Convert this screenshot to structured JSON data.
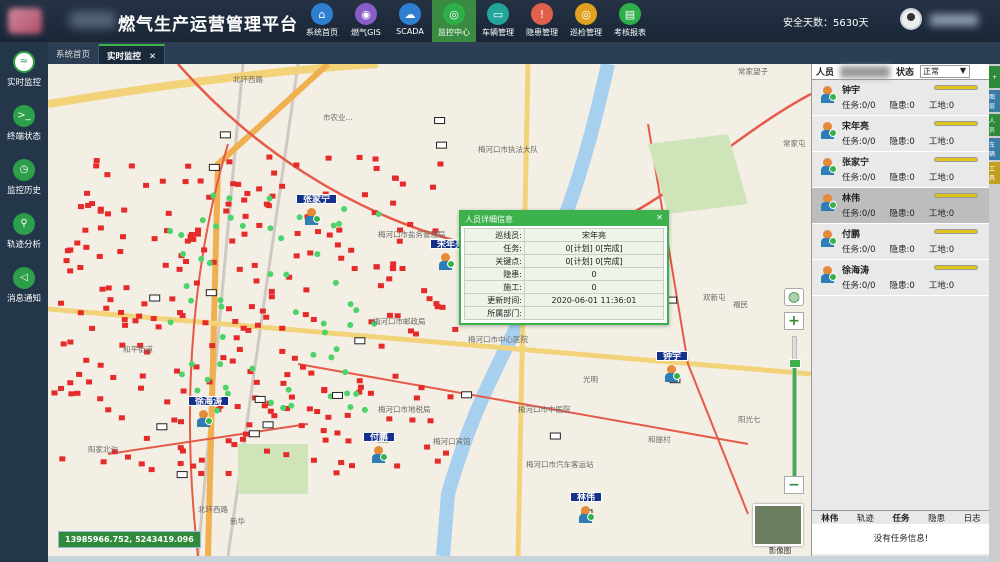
{
  "app": {
    "title": "燃气生产运营管理平台",
    "safety_days": "安全天数：5630天"
  },
  "nav": [
    {
      "label": "系统首页",
      "icon": "home-icon",
      "glyph": "⌂",
      "color": "#2f7fd0",
      "active": false
    },
    {
      "label": "燃气GIS",
      "icon": "map-pin-icon",
      "glyph": "◉",
      "color": "#8a5cc8",
      "active": false
    },
    {
      "label": "SCADA",
      "icon": "cloud-icon",
      "glyph": "☁",
      "color": "#2f7fd0",
      "active": false
    },
    {
      "label": "监控中心",
      "icon": "monitor-icon",
      "glyph": "◎",
      "color": "#2db04a",
      "active": true
    },
    {
      "label": "车辆管理",
      "icon": "car-icon",
      "glyph": "▭",
      "color": "#22a59a",
      "active": false
    },
    {
      "label": "隐患管理",
      "icon": "warning-icon",
      "glyph": "!",
      "color": "#e0604c",
      "active": false
    },
    {
      "label": "巡检管理",
      "icon": "inspection-icon",
      "glyph": "◎",
      "color": "#e0a020",
      "active": false
    },
    {
      "label": "考核报表",
      "icon": "report-icon",
      "glyph": "▤",
      "color": "#2db04a",
      "active": false
    }
  ],
  "sidebar": [
    {
      "label": "实时监控",
      "icon": "realtime-monitor-icon",
      "glyph": "≈",
      "active": true
    },
    {
      "label": "终端状态",
      "icon": "terminal-icon",
      "glyph": ">_",
      "active": true
    },
    {
      "label": "监控历史",
      "icon": "history-icon",
      "glyph": "◷",
      "active": false
    },
    {
      "label": "轨迹分析",
      "icon": "track-icon",
      "glyph": "⚲",
      "active": false
    },
    {
      "label": "消息通知",
      "icon": "message-icon",
      "glyph": "◁",
      "active": false
    }
  ],
  "tabs": [
    {
      "label": "系统首页",
      "active": false
    },
    {
      "label": "实时监控",
      "active": true,
      "close": "✕"
    }
  ],
  "map": {
    "coords": "13985966.752, 5243419.096",
    "labels": [
      "北环西路",
      "常家望子",
      "常家屯",
      "市农业...",
      "梅河口市执法大队",
      "梅河口市盐务管理局",
      "和平街道",
      "梅河口市邮政局",
      "梅河口市中心医院",
      "光明",
      "梅河口市中医院",
      "梅河口市地税局",
      "梅河口宾馆",
      "梅河口市汽车客运站",
      "阳光七",
      "和提村",
      "阳家北沟",
      "双新屯",
      "福民",
      "新华",
      "北环西路",
      "影像图"
    ],
    "persons": [
      {
        "name": "张家宁"
      },
      {
        "name": "宋年亮"
      },
      {
        "name": "钟宇"
      },
      {
        "name": "徐海涛"
      },
      {
        "name": "付鹏"
      },
      {
        "name": "林伟"
      }
    ],
    "popup": {
      "title": "人员详细信息",
      "close": "✕",
      "rows": [
        {
          "k": "巡线员:",
          "v": "宋年亮"
        },
        {
          "k": "任务:",
          "v": "0[计划]  0[完成]"
        },
        {
          "k": "关键点:",
          "v": "0[计划]  0[完成]"
        },
        {
          "k": "隐患:",
          "v": "0"
        },
        {
          "k": "施工:",
          "v": "0"
        },
        {
          "k": "更新时间:",
          "v": "2020-06-01 11:36:01"
        },
        {
          "k": "所属部门:",
          "v": ""
        }
      ]
    },
    "controls": {
      "globe": "◍",
      "zoom_in": "+",
      "zoom_out": "−",
      "basemap_label": "影像图"
    }
  },
  "panel": {
    "header_person": "人员",
    "header_status": "状态",
    "status_value": "正常",
    "status_arrow": "▼",
    "people": [
      {
        "name": "钟宇",
        "task": "任务:0/0",
        "hazard": "隐患:0",
        "site": "工地:0",
        "selected": false
      },
      {
        "name": "宋年亮",
        "task": "任务:0/0",
        "hazard": "隐患:0",
        "site": "工地:0",
        "selected": false
      },
      {
        "name": "张家宁",
        "task": "任务:0/0",
        "hazard": "隐患:0",
        "site": "工地:0",
        "selected": false
      },
      {
        "name": "林伟",
        "task": "任务:0/0",
        "hazard": "隐患:0",
        "site": "工地:0",
        "selected": true
      },
      {
        "name": "付鹏",
        "task": "任务:0/0",
        "hazard": "隐患:0",
        "site": "工地:0",
        "selected": false
      },
      {
        "name": "徐海涛",
        "task": "任务:0/0",
        "hazard": "隐患:0",
        "site": "工地:0",
        "selected": false
      }
    ],
    "footer": {
      "name": "林伟",
      "tabs": [
        "轨迹",
        "任务",
        "隐患",
        "日志"
      ],
      "empty": "没有任务信息!"
    }
  },
  "rightstrip": [
    "+",
    "图层",
    "人员",
    "车辆",
    "工具"
  ]
}
